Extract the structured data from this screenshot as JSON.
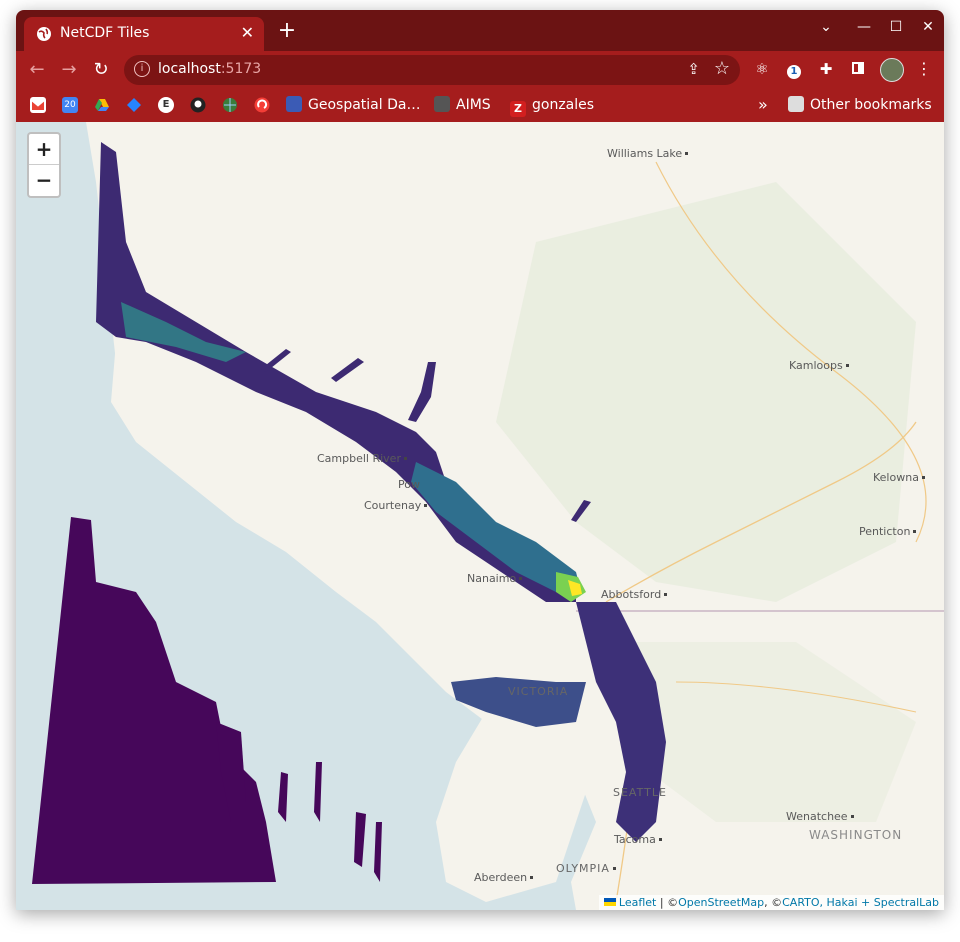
{
  "browser": {
    "tab_title": "NetCDF Tiles",
    "tab_close": "✕",
    "new_tab": "+",
    "url_host": "localhost",
    "url_port": ":5173",
    "window_controls": {
      "tabs_list": "⌄",
      "minimize": "—",
      "maximize": "☐",
      "close": "✕"
    },
    "nav": {
      "back": "←",
      "forward": "→",
      "reload": "↻"
    },
    "menu": "⋮",
    "bookmarks": [
      {
        "label": "Geospatial Da…",
        "color": "#3b5bb5"
      },
      {
        "label": "AIMS",
        "color": "#555555"
      },
      {
        "label": "gonzales",
        "color": "#d21f1f"
      }
    ],
    "bookmark_overflow": "»",
    "other_bookmarks": "Other bookmarks"
  },
  "map": {
    "zoom_in": "+",
    "zoom_out": "−",
    "places": [
      {
        "name": "Williams Lake"
      },
      {
        "name": "Kamloops"
      },
      {
        "name": "Campbell River"
      },
      {
        "name": "Pow"
      },
      {
        "name": "Courtenay"
      },
      {
        "name": "Kelowna"
      },
      {
        "name": "Penticton"
      },
      {
        "name": "Nanaimo"
      },
      {
        "name": "Abbotsford"
      },
      {
        "name": "VICTORIA"
      },
      {
        "name": "SEATTLE"
      },
      {
        "name": "Wenatchee"
      },
      {
        "name": "WASHINGTON"
      },
      {
        "name": "Tacoma"
      },
      {
        "name": "Aberdeen"
      },
      {
        "name": "OLYMPIA"
      }
    ],
    "attribution": {
      "leaflet": "Leaflet",
      "sep": " | ©",
      "osm": "OpenStreetMap",
      "sep2": ", ©",
      "carto": "CARTO, Hakai + SpectralLab"
    },
    "colors": {
      "water": "#d4e3e7",
      "land": "#f5f3ec",
      "data_low": "#46075a",
      "data_mid": "#2f6f8e",
      "data_high": "#fde725"
    }
  }
}
